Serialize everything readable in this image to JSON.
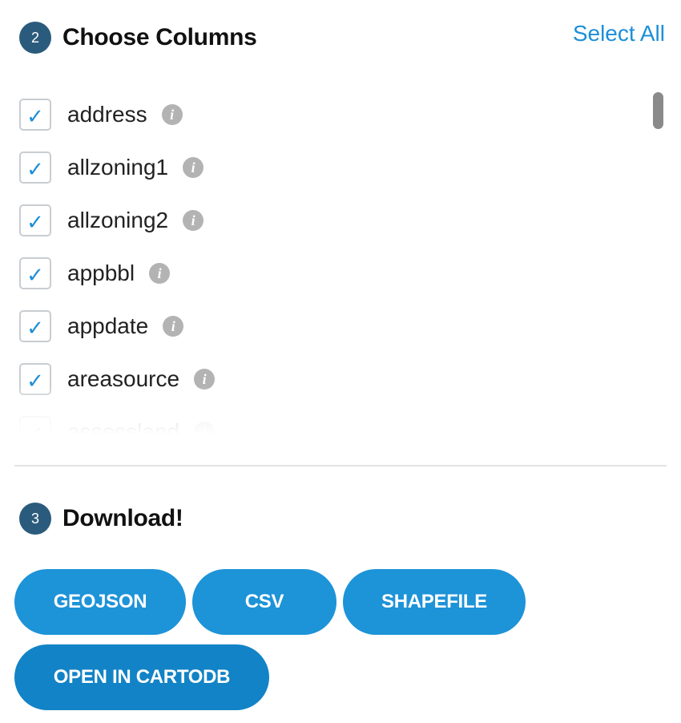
{
  "choose_columns": {
    "step_number": "2",
    "title": "Choose Columns",
    "select_all_label": "Select All",
    "columns": [
      {
        "name": "address",
        "checked": true
      },
      {
        "name": "allzoning1",
        "checked": true
      },
      {
        "name": "allzoning2",
        "checked": true
      },
      {
        "name": "appbbl",
        "checked": true
      },
      {
        "name": "appdate",
        "checked": true
      },
      {
        "name": "areasource",
        "checked": true
      },
      {
        "name": "assessland",
        "checked": true
      }
    ],
    "check_glyph": "✓",
    "info_glyph": "i"
  },
  "download": {
    "step_number": "3",
    "title": "Download!",
    "buttons": {
      "geojson": "GEOJSON",
      "csv": "CSV",
      "shapefile": "SHAPEFILE",
      "cartodb": "OPEN IN CARTODB"
    }
  },
  "colors": {
    "accent": "#1d93d8",
    "badge": "#2b5b7c",
    "link": "#1d8fd6"
  }
}
